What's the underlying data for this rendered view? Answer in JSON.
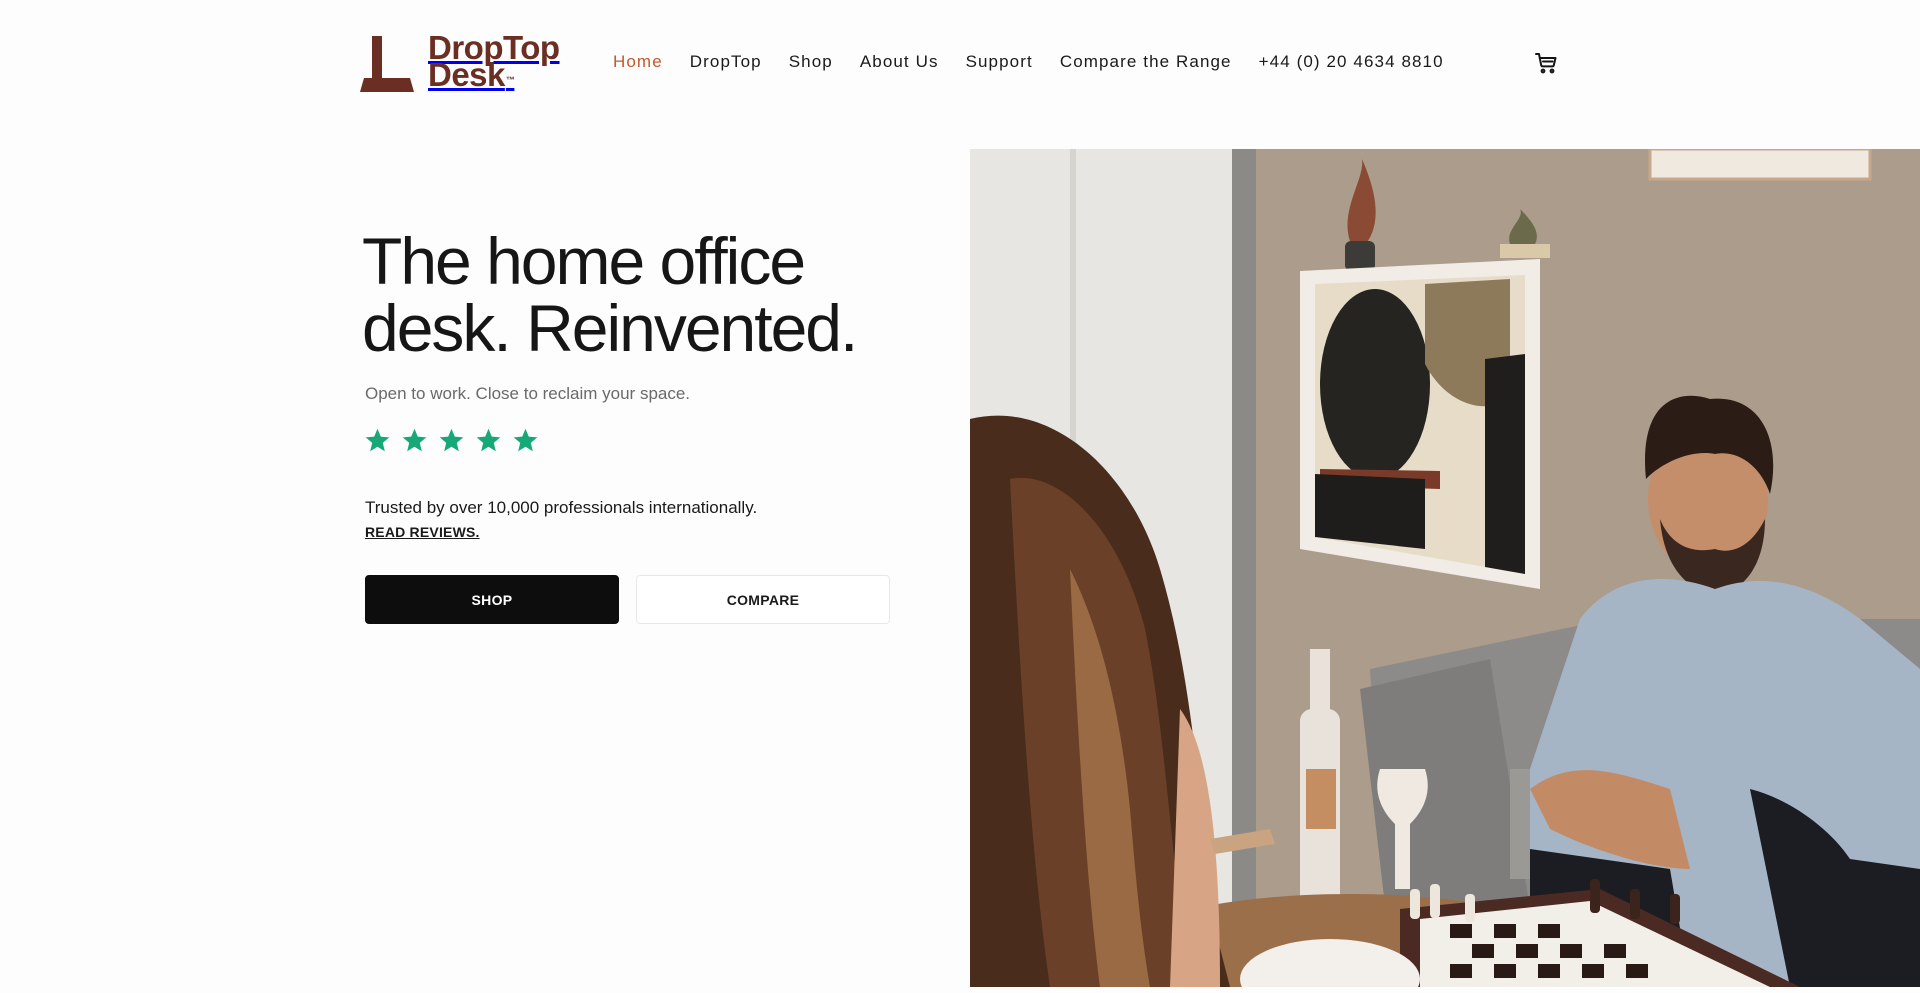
{
  "brand": {
    "line1": "DropTop",
    "line2": "Desk",
    "trademark": "™",
    "color": "#6b2e22"
  },
  "nav": {
    "items": [
      {
        "label": "Home",
        "active": true
      },
      {
        "label": "DropTop",
        "active": false
      },
      {
        "label": "Shop",
        "active": false
      },
      {
        "label": "About Us",
        "active": false
      },
      {
        "label": "Support",
        "active": false
      },
      {
        "label": "Compare the Range",
        "active": false
      },
      {
        "label": "+44 (0) 20 4634 8810",
        "active": false
      }
    ],
    "active_color": "#c4582c",
    "cart_icon": "cart-icon"
  },
  "hero": {
    "title_line1": "The home office",
    "title_line2": "desk. Reinvented.",
    "subtitle": "Open to work. Close to reclaim your space.",
    "rating": {
      "value": 5,
      "max": 5,
      "color": "#17a878"
    },
    "trusted": "Trusted by over 10,000 professionals internationally.",
    "read_reviews": "READ REVIEWS.",
    "shop_button": "SHOP",
    "compare_button": "COMPARE"
  }
}
